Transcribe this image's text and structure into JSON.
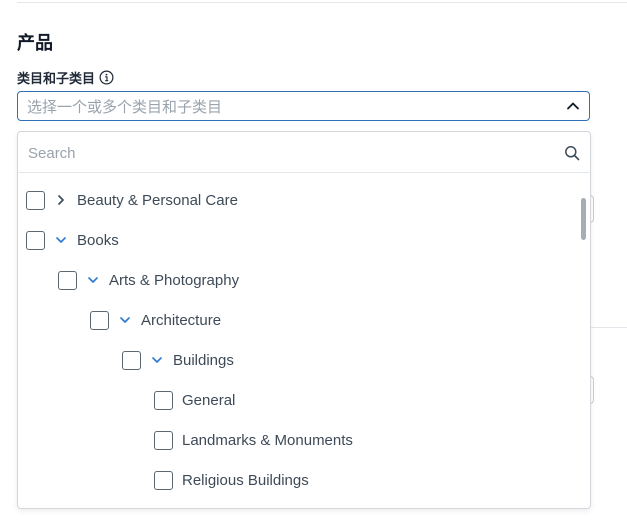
{
  "section": {
    "title": "产品"
  },
  "field": {
    "label": "类目和子类目",
    "placeholder": "选择一个或多个类目和子类目",
    "info_icon": "info-icon",
    "toggle_icon": "chevron-up-icon"
  },
  "dropdown": {
    "search_placeholder": "Search",
    "search_icon": "search-icon",
    "items": [
      {
        "label": "Beauty & Personal Care",
        "level": 0,
        "expandable": true,
        "expanded": false,
        "checked": false
      },
      {
        "label": "Books",
        "level": 0,
        "expandable": true,
        "expanded": true,
        "checked": false
      },
      {
        "label": "Arts & Photography",
        "level": 1,
        "expandable": true,
        "expanded": true,
        "checked": false
      },
      {
        "label": "Architecture",
        "level": 2,
        "expandable": true,
        "expanded": true,
        "checked": false
      },
      {
        "label": "Buildings",
        "level": 3,
        "expandable": true,
        "expanded": true,
        "checked": false
      },
      {
        "label": "General",
        "level": 4,
        "expandable": false,
        "expanded": false,
        "checked": false
      },
      {
        "label": "Landmarks & Monuments",
        "level": 4,
        "expandable": false,
        "expanded": false,
        "checked": false
      },
      {
        "label": "Religious Buildings",
        "level": 4,
        "expandable": false,
        "expanded": false,
        "checked": false
      }
    ]
  },
  "colors": {
    "accent": "#2f6fb5",
    "chevron": "#2f7bd6",
    "text": "#3d4a57"
  }
}
